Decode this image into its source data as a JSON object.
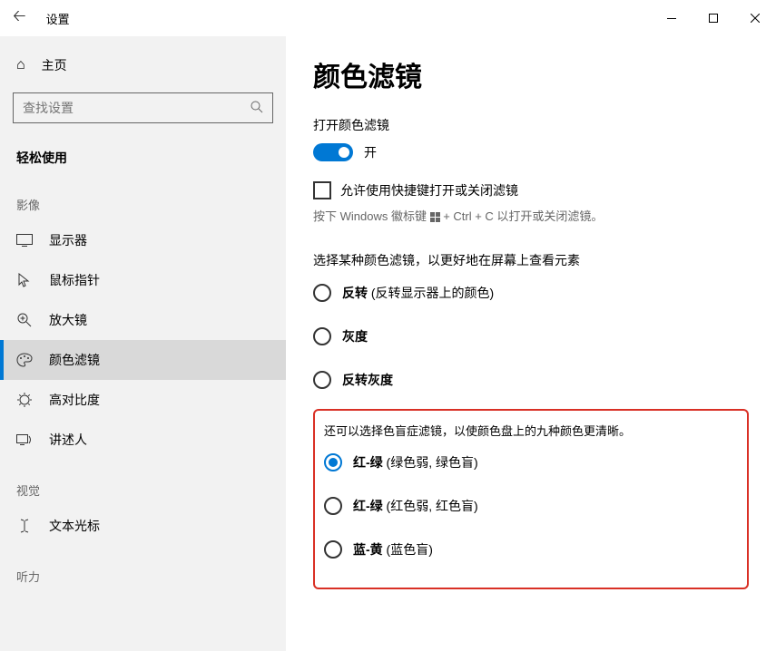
{
  "titlebar": {
    "title": "设置"
  },
  "sidebar": {
    "home": "主页",
    "search_placeholder": "查找设置",
    "category": "轻松使用",
    "sections": {
      "visual": "影像",
      "vision2": "视觉",
      "hearing": "听力"
    },
    "items": {
      "display": "显示器",
      "cursor": "鼠标指针",
      "magnifier": "放大镜",
      "colorfilters": "颜色滤镜",
      "highcontrast": "高对比度",
      "narrator": "讲述人",
      "textcursor": "文本光标"
    }
  },
  "main": {
    "title": "颜色滤镜",
    "toggle_section": "打开颜色滤镜",
    "toggle_state": "开",
    "checkbox_label": "允许使用快捷键打开或关闭滤镜",
    "hint_prefix": "按下 Windows 徽标键 ",
    "hint_suffix": " + Ctrl + C 以打开或关闭滤镜。",
    "filter_desc": "选择某种颜色滤镜，以更好地在屏幕上查看元素",
    "filters": {
      "inverted": {
        "bold": "反转",
        "rest": " (反转显示器上的颜色)"
      },
      "grayscale": {
        "bold": "灰度",
        "rest": ""
      },
      "grayinverted": {
        "bold": "反转灰度",
        "rest": ""
      }
    },
    "colorblind_desc": "还可以选择色盲症滤镜，以使颜色盘上的九种颜色更清晰。",
    "cb": {
      "deut": {
        "bold": "红-绿",
        "rest": " (绿色弱, 绿色盲)"
      },
      "prot": {
        "bold": "红-绿",
        "rest": " (红色弱, 红色盲)"
      },
      "trit": {
        "bold": "蓝-黄",
        "rest": " (蓝色盲)"
      }
    }
  }
}
